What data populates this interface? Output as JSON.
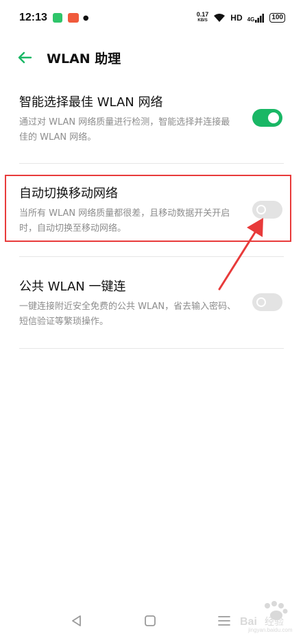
{
  "status_bar": {
    "time": "12:13",
    "net_speed_value": "0.17",
    "net_speed_unit": "KB/S",
    "hd_label": "HD",
    "signal_label": "4G",
    "battery_level": "100"
  },
  "header": {
    "title": "WLAN 助理"
  },
  "settings": [
    {
      "title": "智能选择最佳 WLAN 网络",
      "description": "通过对 WLAN 网络质量进行检测，智能选择并连接最佳的 WLAN 网络。",
      "enabled": true
    },
    {
      "title": "自动切换移动网络",
      "description": "当所有 WLAN 网络质量都很差，且移动数据开关开启时，自动切换至移动网络。",
      "enabled": false
    },
    {
      "title": "公共 WLAN 一键连",
      "description": "一键连接附近安全免费的公共 WLAN，省去输入密码、短信验证等繁琐操作。",
      "enabled": false
    }
  ],
  "colors": {
    "toggle_on": "#19b765",
    "toggle_off": "#e3e3e3",
    "accent": "#19b765",
    "annotation": "#e83a3a"
  },
  "watermark": {
    "brand": "Bai",
    "brand_suffix": "经验",
    "url": "jingyan.baidu.com"
  }
}
